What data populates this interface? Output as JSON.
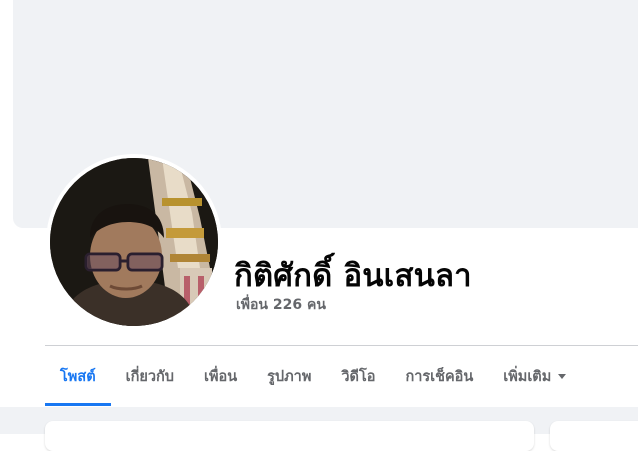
{
  "profile": {
    "name": "กิติศักดิ์ อินเสนลา",
    "friends_count_text": "เพื่อน 226 คน"
  },
  "tabs": [
    {
      "label": "โพสต์",
      "active": true
    },
    {
      "label": "เกี่ยวกับ",
      "active": false
    },
    {
      "label": "เพื่อน",
      "active": false
    },
    {
      "label": "รูปภาพ",
      "active": false
    },
    {
      "label": "วิดีโอ",
      "active": false
    },
    {
      "label": "การเช็คอิน",
      "active": false
    },
    {
      "label": "เพิ่มเติม",
      "active": false,
      "icon": "caret-down-icon"
    }
  ],
  "colors": {
    "accent": "#1877f2",
    "cover_background": "#f0f2f5",
    "secondary_text": "#65676b",
    "primary_text": "#050505"
  }
}
